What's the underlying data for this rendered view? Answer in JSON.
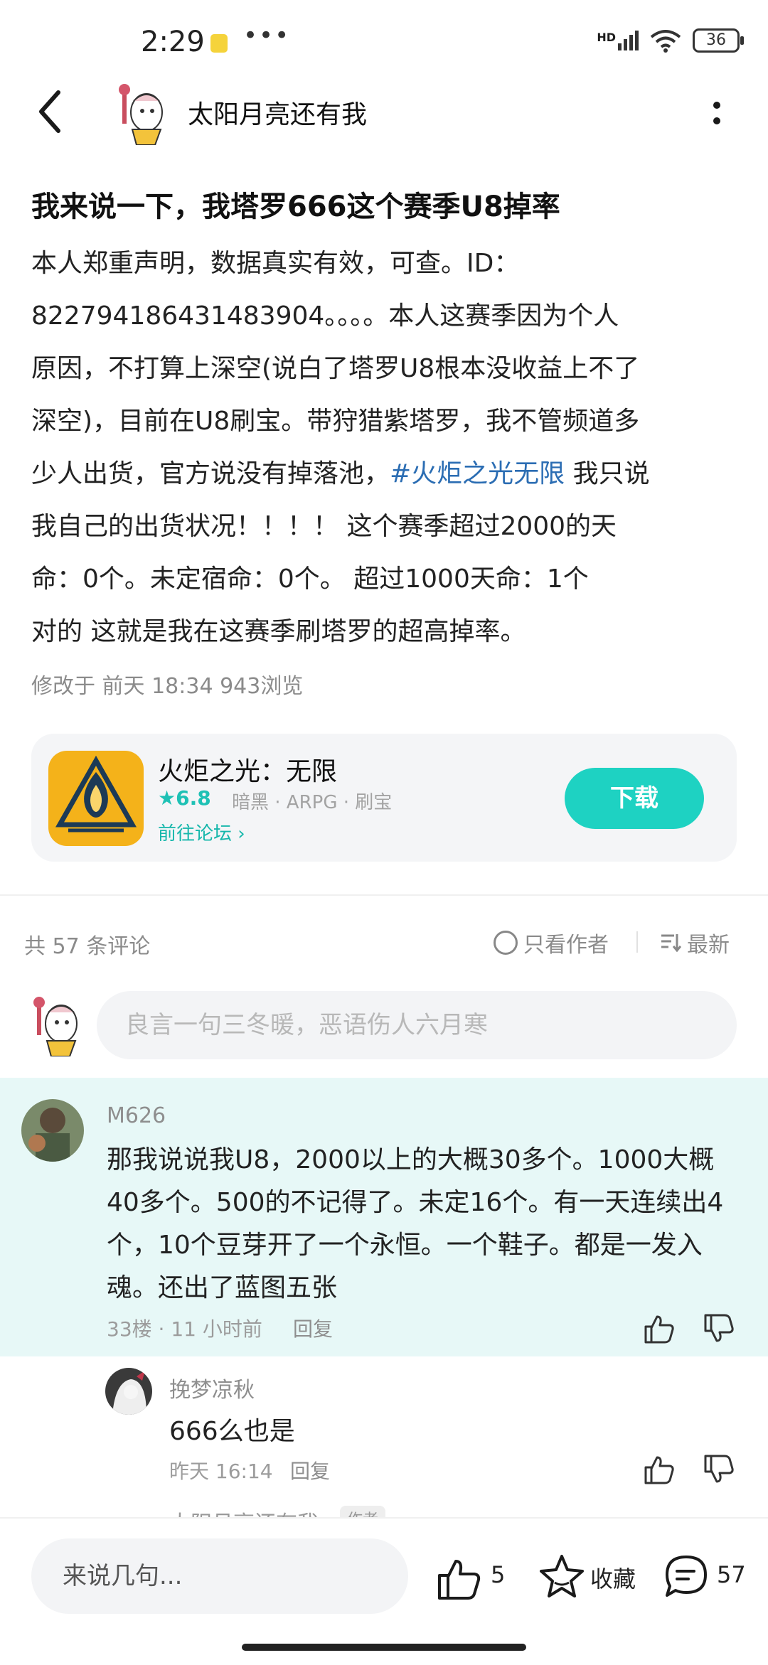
{
  "status_bar": {
    "time": "2:29",
    "dots": "•••",
    "signal": "HD",
    "battery": "36"
  },
  "header": {
    "author_name": "太阳月亮还有我"
  },
  "post": {
    "title": "我来说一下，我塔罗666这个赛季U8掉率",
    "body_before_tag": "本人郑重声明，数据真实有效，可查。ID：\n822794186431483904。。。。本人这赛季因为个人\n原因，不打算上深空(说白了塔罗U8根本没收益上不了\n深空)，目前在U8刷宝。带狩猎紫塔罗，我不管频道多\n少人出货，官方说没有掉落池，",
    "tag": "#火炬之光无限",
    "body_after_tag": " 我只说\n我自己的出货状况！！！！ 这个赛季超过2000的天\n命：0个。未定宿命：0个。 超过1000天命：1个\n对的 这就是我在这赛季刷塔罗的超高掉率。",
    "meta": "修改于  前天 18:34   943浏览"
  },
  "game_card": {
    "name": "火炬之光：无限",
    "rating": "★6.8",
    "tags": "暗黑 · ARPG · 刷宝",
    "forum_link": "前往论坛 ›",
    "download": "下载"
  },
  "comments_header": {
    "count": "共 57 条评论",
    "only_author": "只看作者",
    "sort": "最新"
  },
  "comment_input": {
    "placeholder": "良言一句三冬暖，恶语伤人六月寒"
  },
  "comments": [
    {
      "user": "M626",
      "text": "那我说说我U8，2000以上的大概30多个。1000大概40多个。500的不记得了。未定16个。有一天连续出4个，10个豆芽开了一个永恒。一个鞋子。都是一发入魂。还出了蓝图五张",
      "meta": "33楼 · 11 小时前",
      "reply": "回复"
    }
  ],
  "replies": [
    {
      "user": "挽梦凉秋",
      "text": "666么也是",
      "meta": "昨天 16:14",
      "reply": "回复"
    },
    {
      "user": "太阳月亮还有我",
      "badge": "作者"
    }
  ],
  "bottom_bar": {
    "input": "来说几句...",
    "likes": "5",
    "favorite": "收藏",
    "comments": "57"
  },
  "colors": {
    "accent": "#1ed2c2",
    "link": "#2b6db3",
    "highlight_bg": "#e7f8f7"
  }
}
